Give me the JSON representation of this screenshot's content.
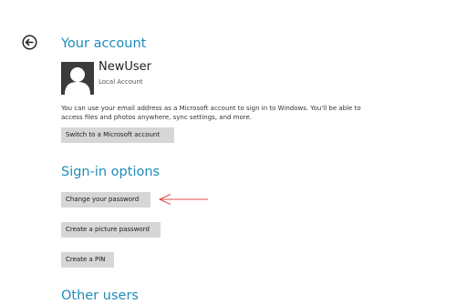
{
  "navigation": {
    "back_icon": "back-arrow-circle-icon"
  },
  "account": {
    "section_title": "Your account",
    "username": "NewUser",
    "account_type": "Local Account",
    "avatar_icon": "user-silhouette-icon",
    "description": "You can use your email address as a Microsoft account to sign in to Windows. You'll be able to access files and photos anywhere, sync settings, and more.",
    "switch_button_label": "Switch to a Microsoft account"
  },
  "signin_options": {
    "section_title": "Sign-in options",
    "change_password_label": "Change your password",
    "picture_password_label": "Create a picture password",
    "pin_label": "Create a PIN"
  },
  "other_users": {
    "section_title": "Other users"
  },
  "annotation": {
    "icon": "red-arrow-left-icon",
    "color": "#e04848"
  },
  "colors": {
    "accent": "#1f8cb8",
    "button_bg": "#d6d6d6",
    "avatar_bg": "#3b3b3b"
  }
}
